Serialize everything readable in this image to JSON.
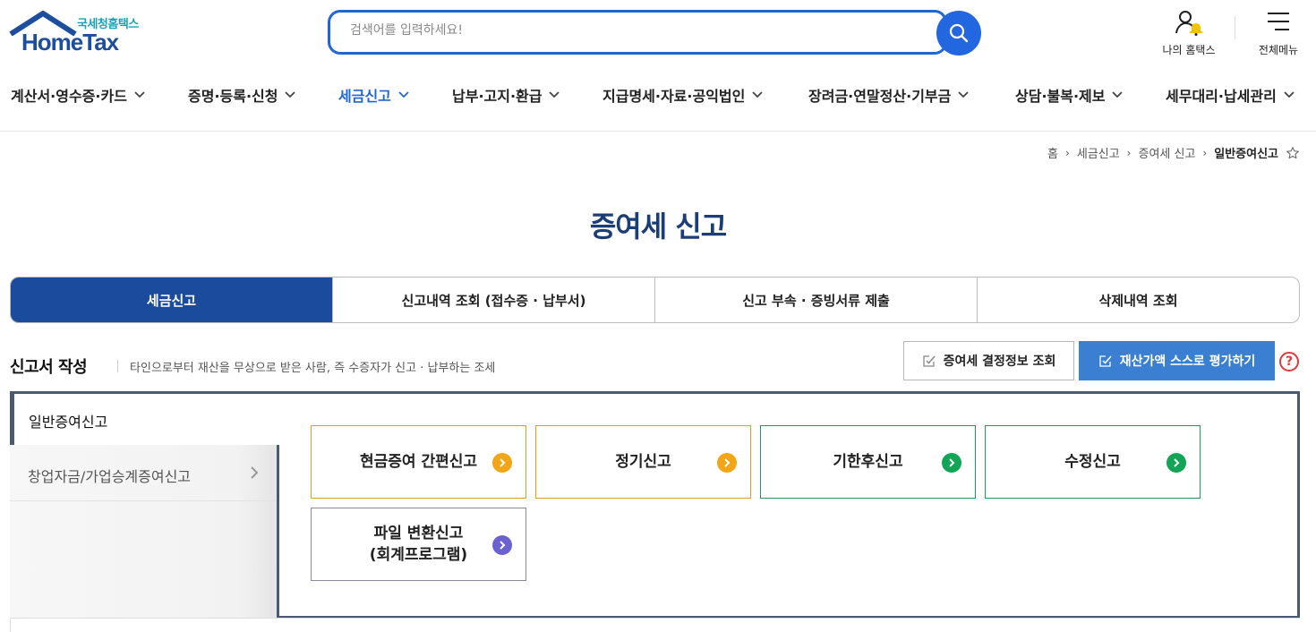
{
  "header": {
    "logo_kr": "국세청홈택스",
    "logo_en": "HomeTax",
    "search_placeholder": "검색어를 입력하세요!",
    "my_hometax": "나의 홈택스",
    "all_menu": "전체메뉴"
  },
  "gnb": [
    {
      "label": "계산서·영수증·카드",
      "active": false
    },
    {
      "label": "증명·등록·신청",
      "active": false
    },
    {
      "label": "세금신고",
      "active": true
    },
    {
      "label": "납부·고지·환급",
      "active": false
    },
    {
      "label": "지급명세·자료·공익법인",
      "active": false
    },
    {
      "label": "장려금·연말정산·기부금",
      "active": false
    },
    {
      "label": "상담·불복·제보",
      "active": false
    },
    {
      "label": "세무대리·납세관리",
      "active": false
    }
  ],
  "breadcrumb": [
    "홈",
    "세금신고",
    "증여세 신고",
    "일반증여신고"
  ],
  "page_title": "증여세 신고",
  "tabs": [
    "세금신고",
    "신고내역 조회 (접수증 · 납부서)",
    "신고 부속 · 증빙서류 제출",
    "삭제내역 조회"
  ],
  "section": {
    "title": "신고서 작성",
    "desc": "타인으로부터 재산을 무상으로 받은 사람, 즉 수증자가 신고 · 납부하는 조세",
    "btn_info": "증여세 결정정보 조회",
    "btn_eval": "재산가액 스스로 평가하기",
    "help": "?"
  },
  "side": [
    "일반증여신고",
    "창업자금/가업승계증여신고"
  ],
  "cards": [
    {
      "label": "현금증여 간편신고",
      "color": "#f2a516"
    },
    {
      "label": "정기신고",
      "color": "#f2a516"
    },
    {
      "label": "기한후신고",
      "color": "#12a556"
    },
    {
      "label": "수정신고",
      "color": "#12a556"
    },
    {
      "label": "파일 변환신고\n(회계프로그램)",
      "label_line1": "파일 변환신고",
      "label_line2": "(회계프로그램)",
      "color": "#6a62d0"
    }
  ]
}
